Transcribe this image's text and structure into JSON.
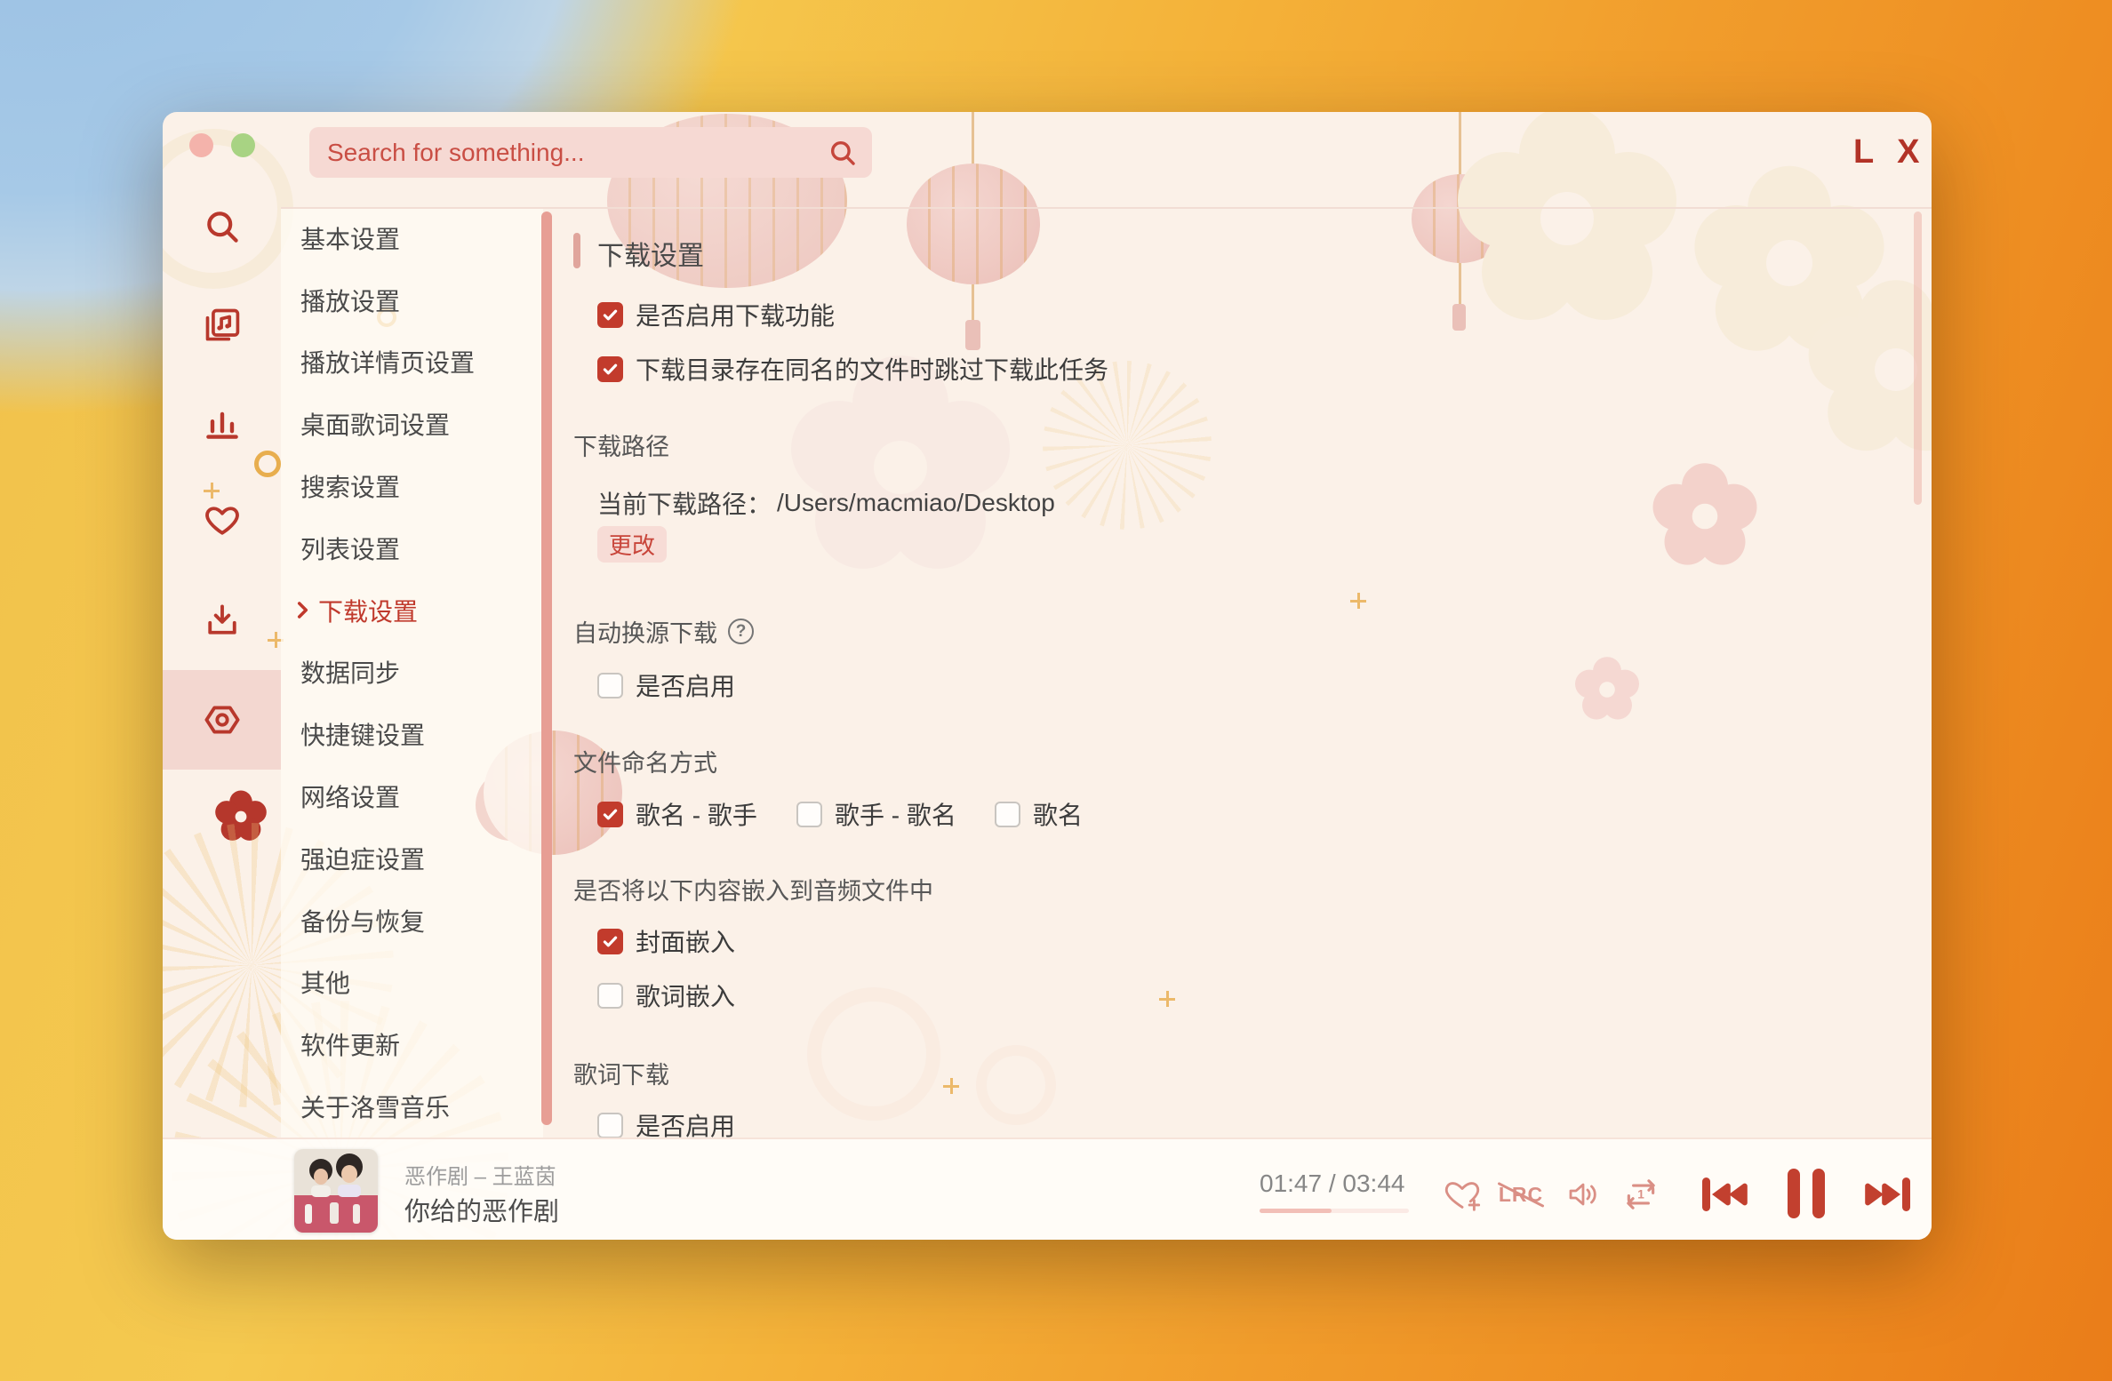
{
  "header": {
    "search_placeholder": "Search for something...",
    "logo": "L X"
  },
  "menu": {
    "items": [
      {
        "label": "基本设置",
        "active": false
      },
      {
        "label": "播放设置",
        "active": false
      },
      {
        "label": "播放详情页设置",
        "active": false
      },
      {
        "label": "桌面歌词设置",
        "active": false
      },
      {
        "label": "搜索设置",
        "active": false
      },
      {
        "label": "列表设置",
        "active": false
      },
      {
        "label": "下载设置",
        "active": true
      },
      {
        "label": "数据同步",
        "active": false
      },
      {
        "label": "快捷键设置",
        "active": false
      },
      {
        "label": "网络设置",
        "active": false
      },
      {
        "label": "强迫症设置",
        "active": false
      },
      {
        "label": "备份与恢复",
        "active": false
      },
      {
        "label": "其他",
        "active": false
      },
      {
        "label": "软件更新",
        "active": false
      },
      {
        "label": "关于洛雪音乐",
        "active": false
      }
    ]
  },
  "settings": {
    "title": "下载设置",
    "enable_download_label": "是否启用下载功能",
    "enable_download_checked": true,
    "skip_existing_label": "下载目录存在同名的文件时跳过下载此任务",
    "skip_existing_checked": true,
    "download_path_section": "下载路径",
    "current_path_label": "当前下载路径：",
    "current_path_value": "/Users/macmiao/Desktop",
    "change_button": "更改",
    "auto_change_source_section": "自动换源下载",
    "auto_change_source_enable_label": "是否启用",
    "auto_change_source_enable_checked": false,
    "file_naming_section": "文件命名方式",
    "naming_options": [
      {
        "label": "歌名 - 歌手",
        "checked": true
      },
      {
        "label": "歌手 - 歌名",
        "checked": false
      },
      {
        "label": "歌名",
        "checked": false
      }
    ],
    "embed_section": "是否将以下内容嵌入到音频文件中",
    "embed_options": [
      {
        "label": "封面嵌入",
        "checked": true
      },
      {
        "label": "歌词嵌入",
        "checked": false
      }
    ],
    "lyrics_download_section": "歌词下载",
    "lyrics_download_enable_label": "是否启用",
    "lyrics_download_enable_checked": false
  },
  "player": {
    "track_meta": "恶作剧 – 王蓝茵",
    "track_title": "你给的恶作剧",
    "time_display": "01:47 / 03:44",
    "progress_percent": 48,
    "lrc_label": "LRC"
  },
  "colors": {
    "accent_red": "#c0392c",
    "checkbox_red": "#c23b2c",
    "scrollbar_pink": "#e79e94",
    "sidebar_highlight": "#f3d7d0"
  }
}
